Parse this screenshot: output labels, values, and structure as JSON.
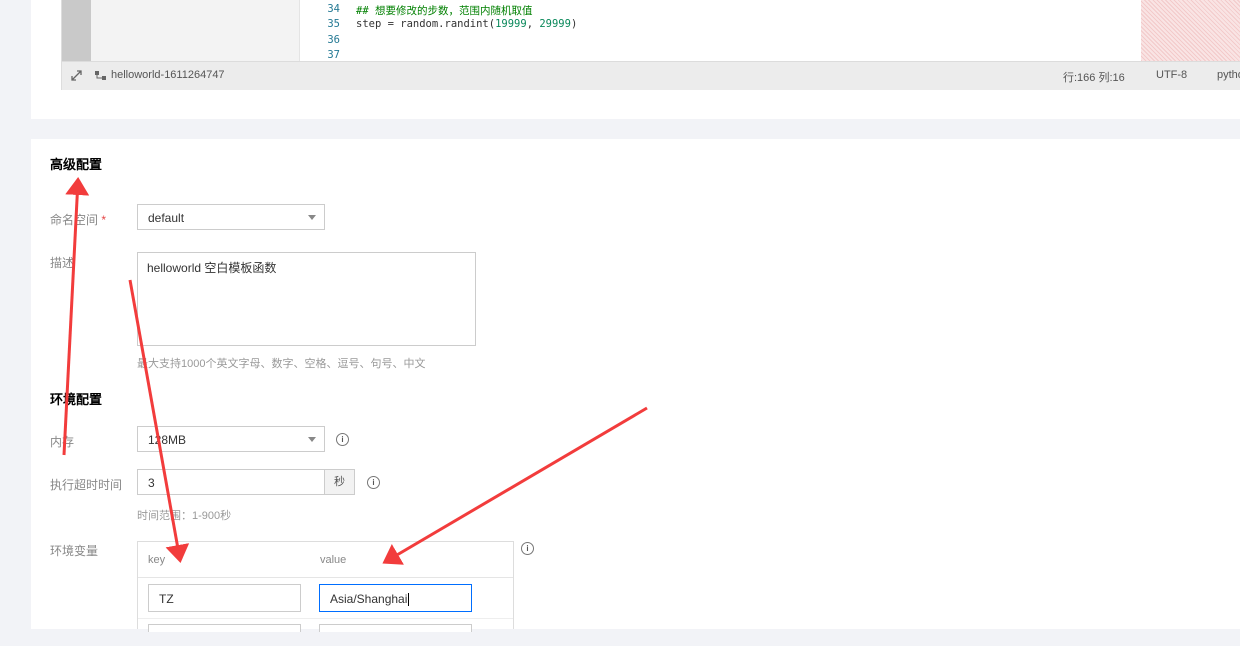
{
  "editor": {
    "lines": [
      {
        "no": "34",
        "code": "## 想要修改的步数，范围内随机取值",
        "kind": "comment"
      },
      {
        "no": "35",
        "code_pre": "step = random.randint(",
        "num1": "19999",
        "sep": ", ",
        "num2": "29999",
        "code_post": ")",
        "kind": "code"
      },
      {
        "no": "36",
        "code": "",
        "kind": "blank"
      },
      {
        "no": "37",
        "code": "",
        "kind": "blank"
      }
    ],
    "status": {
      "function_name": "helloworld-1611264747",
      "cursor": "行:166 列:16",
      "encoding": "UTF-8",
      "language": "pytho"
    }
  },
  "advanced": {
    "title": "高级配置",
    "namespace_label": "命名空间",
    "required_mark": "*",
    "namespace_value": "default",
    "desc_label": "描述",
    "desc_value": "helloworld 空白模板函数",
    "desc_hint": "最大支持1000个英文字母、数字、空格、逗号、句号、中文"
  },
  "env": {
    "title": "环境配置",
    "memory_label": "内存",
    "memory_value": "128MB",
    "timeout_label": "执行超时时间",
    "timeout_value": "3",
    "timeout_unit": "秒",
    "timeout_hint": "时间范围：1-900秒",
    "vars_label": "环境变量",
    "col_key": "key",
    "col_value": "value",
    "rows": [
      {
        "key": "TZ",
        "value": "Asia/Shanghai"
      },
      {
        "key": "",
        "value": ""
      }
    ]
  },
  "colors": {
    "arrow": "#f23c3c",
    "focus": "#006eff",
    "required": "#e54545"
  }
}
